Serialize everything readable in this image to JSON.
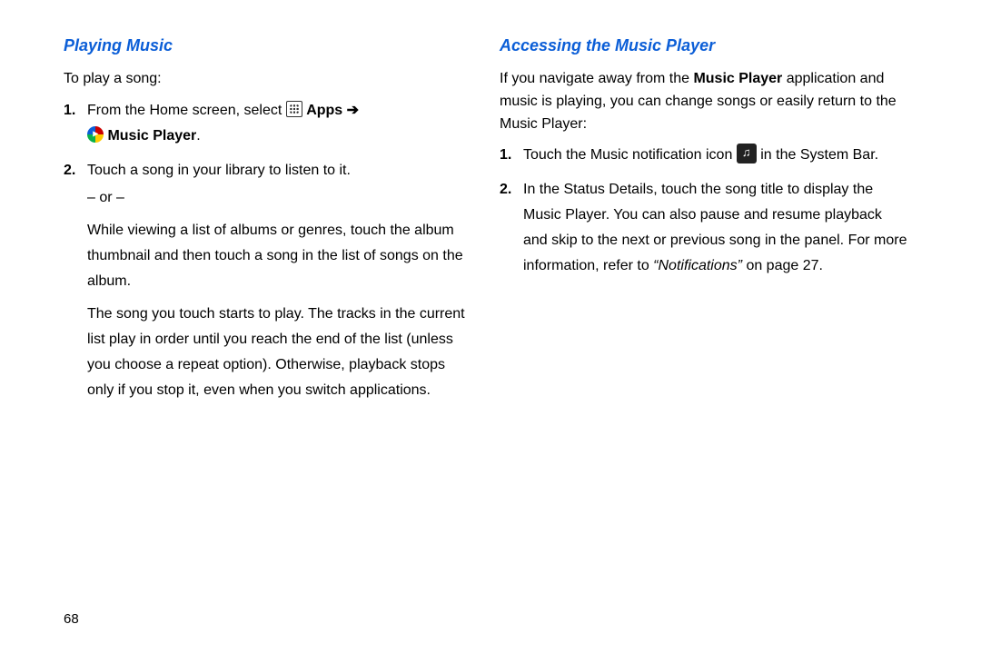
{
  "left": {
    "heading": "Playing Music",
    "intro": "To play a song:",
    "steps": [
      {
        "num": "1.",
        "text_before": "From the Home screen, select ",
        "apps_label": "Apps",
        "arrow": "➔",
        "music_player_label": "Music Player",
        "period": "."
      },
      {
        "num": "2.",
        "line1": "Touch a song in your library to listen to it.",
        "or": "– or –",
        "para1": "While viewing a list of albums or genres, touch the album thumbnail and then touch a song in the list of songs on the album.",
        "para2": "The song you touch starts to play. The tracks in the current list play in order until you reach the end of the list (unless you choose a repeat option). Otherwise, playback stops only if you stop it, even when you switch applications."
      }
    ]
  },
  "right": {
    "heading": "Accessing the Music Player",
    "intro_before": "If you navigate away from the ",
    "intro_bold": "Music Player",
    "intro_after": " application and music is playing, you can change songs or easily return to the Music Player:",
    "steps": [
      {
        "num": "1.",
        "before": "Touch the Music notification icon ",
        "after": " in the System Bar."
      },
      {
        "num": "2.",
        "text_before": "In the Status Details, touch the song title to display the Music Player. You can also pause and resume playback and skip to the next or previous song in the panel. For more information, refer to ",
        "ref_italic": "“Notifications”",
        "ref_after": " on page 27."
      }
    ]
  },
  "page_number": "68"
}
